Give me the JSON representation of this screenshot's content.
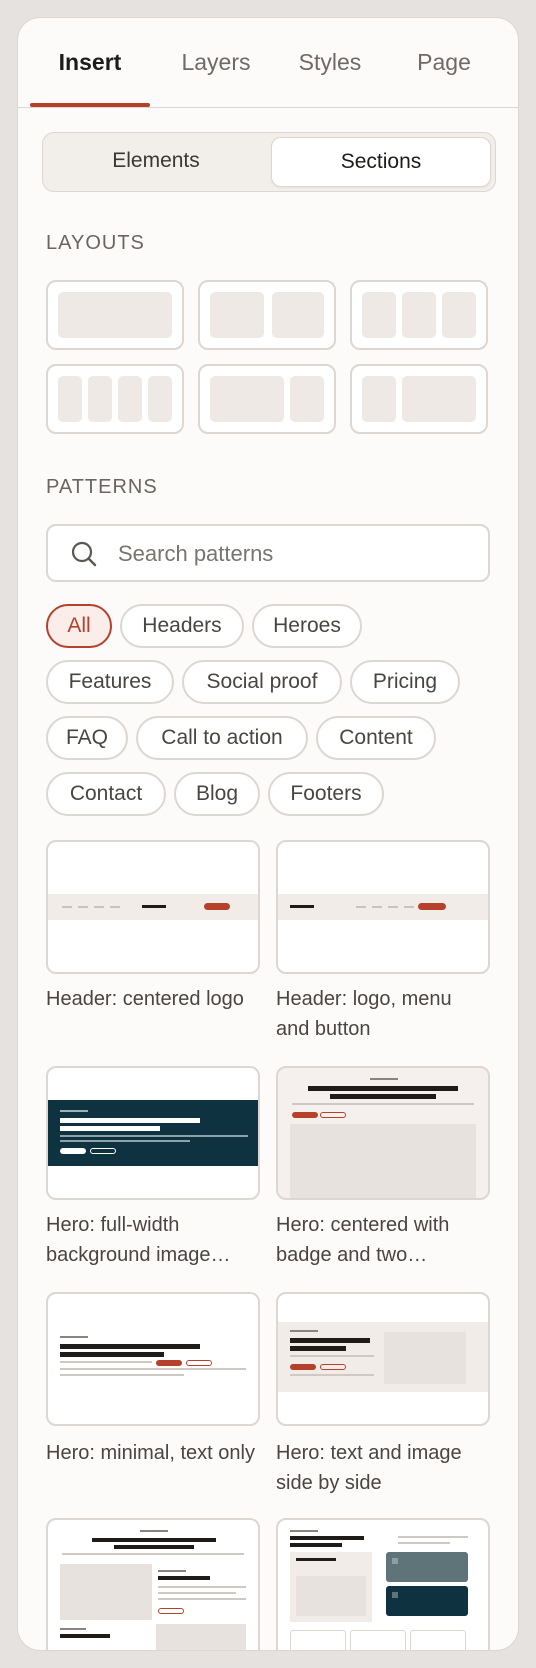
{
  "tabs": [
    {
      "label": "Insert",
      "active": true
    },
    {
      "label": "Layers"
    },
    {
      "label": "Styles"
    },
    {
      "label": "Page"
    }
  ],
  "segmented": {
    "elements": "Elements",
    "sections": "Sections",
    "active": "Sections"
  },
  "layouts": {
    "label": "LAYOUTS",
    "items": [
      "1 column",
      "2 columns",
      "3 columns",
      "4 columns",
      "2/3 + 1/3",
      "1/3 + 2/3"
    ]
  },
  "patterns": {
    "label": "PATTERNS",
    "search_placeholder": "Search patterns",
    "search_value": "",
    "filters": [
      {
        "label": "All",
        "active": true
      },
      {
        "label": "Headers"
      },
      {
        "label": "Heroes"
      },
      {
        "label": "Features"
      },
      {
        "label": "Social proof"
      },
      {
        "label": "Pricing"
      },
      {
        "label": "FAQ"
      },
      {
        "label": "Call to action"
      },
      {
        "label": "Content"
      },
      {
        "label": "Contact"
      },
      {
        "label": "Blog"
      },
      {
        "label": "Footers"
      }
    ],
    "items": [
      {
        "caption": "Header: centered logo"
      },
      {
        "caption": "Header: logo, menu and button"
      },
      {
        "caption": "Hero: full-width background image…"
      },
      {
        "caption": "Hero: centered with badge and two…"
      },
      {
        "caption": "Hero: minimal, text only"
      },
      {
        "caption": "Hero: text and image side by side"
      }
    ]
  },
  "colors": {
    "accent": "#b5412b",
    "dark": "#0e3240",
    "muted": "#efe9e5",
    "border": "#ddd6d1"
  }
}
